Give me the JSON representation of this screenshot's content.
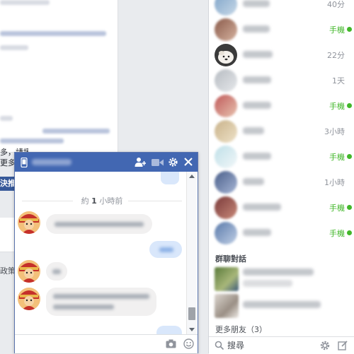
{
  "feed": {
    "line_text": "多，請援加球菜實助方，可",
    "line_text2": "更多",
    "button_label": "決推薦",
    "side_text": "政策"
  },
  "chat_window": {
    "timestamp_prefix": "約",
    "timestamp_num": "1",
    "timestamp_suffix": " 小時前"
  },
  "sidebar": {
    "contacts": [
      {
        "status": "40分",
        "mobile": false
      },
      {
        "status": "手機",
        "mobile": true
      },
      {
        "status": "22分",
        "mobile": false
      },
      {
        "status": "1天",
        "mobile": false
      },
      {
        "status": "手機",
        "mobile": true
      },
      {
        "status": "3小時",
        "mobile": false
      },
      {
        "status": "手機",
        "mobile": true
      },
      {
        "status": "1小時",
        "mobile": false
      },
      {
        "status": "手機",
        "mobile": true
      },
      {
        "status": "手機",
        "mobile": true
      }
    ],
    "group_section_title": "群聊對話",
    "more_friends_label": "更多朋友（3）",
    "search_placeholder": "搜尋"
  },
  "colors": {
    "header_blue": "#4267b2",
    "online_green": "#42b72a",
    "gray_text": "#90949c"
  },
  "icons": [
    "phone-icon",
    "add-people-icon",
    "video-camera-icon",
    "gear-icon",
    "close-icon",
    "camera-icon",
    "emoji-icon",
    "search-icon",
    "compose-icon"
  ]
}
